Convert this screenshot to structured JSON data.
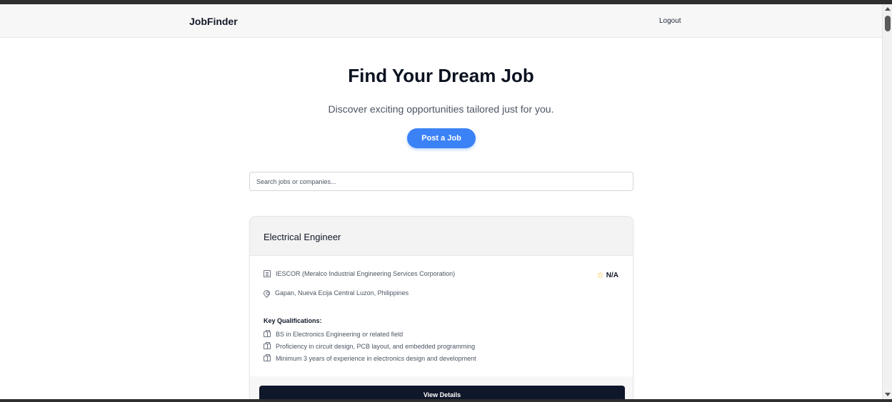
{
  "navbar": {
    "brand": "JobFinder",
    "logout_label": "Logout"
  },
  "hero": {
    "title": "Find Your Dream Job",
    "subtitle": "Discover exciting opportunities tailored just for you.",
    "post_job_label": "Post a Job"
  },
  "search": {
    "placeholder": "Search jobs or companies..."
  },
  "job_card": {
    "title": "Electrical Engineer",
    "company": "IESCOR (Meralco Industrial Engineering Services Corporation)",
    "location": "Gapan, Nueva Ecija Central Luzon, Philippines",
    "rating": "N/A",
    "qualifications_heading": "Key Qualifications:",
    "qualifications": [
      "BS in Electronics Engineering or related field",
      "Proficiency in circuit design, PCB layout, and embedded programming",
      "Minimum 3 years of experience in electronics design and development"
    ],
    "view_details_label": "View Details"
  },
  "colors": {
    "primary": "#3b82f6",
    "dark_button": "#0f172a",
    "star": "#f5b301"
  },
  "icons": {
    "company": "building-icon",
    "location": "map-pin-icon",
    "qualification": "briefcase-icon",
    "rating": "star-icon"
  }
}
